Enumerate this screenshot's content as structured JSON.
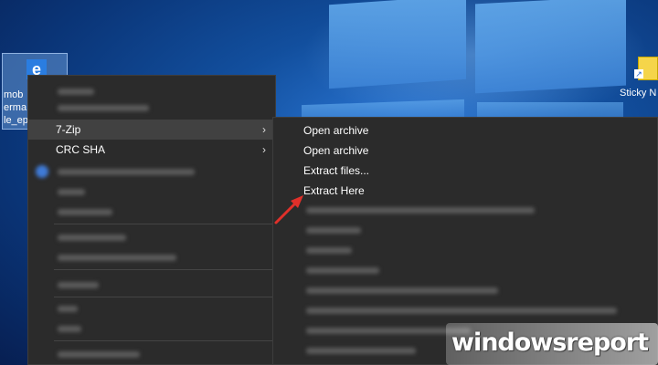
{
  "desktop": {
    "selected_icon": {
      "label": "mob\nerma\nle_ep",
      "icon": "edge-icon"
    },
    "sticky_icon": {
      "label": "Sticky N",
      "icon": "sticky-notes-icon"
    }
  },
  "context_menu": {
    "items": [
      {
        "label": "7-Zip",
        "has_submenu": true,
        "highlighted": true
      },
      {
        "label": "CRC SHA",
        "has_submenu": true,
        "highlighted": false
      }
    ]
  },
  "submenu_7zip": {
    "items": [
      {
        "label": "Open archive"
      },
      {
        "label": "Open archive"
      },
      {
        "label": "Extract files..."
      },
      {
        "label": "Extract Here"
      }
    ]
  },
  "annotation": {
    "color": "#e0302a",
    "icon": "red-arrow-icon"
  },
  "watermark": {
    "text": "windowsreport"
  },
  "colors": {
    "menu_bg": "#2b2b2b",
    "menu_highlight": "#414141",
    "desktop_accent": "#1a5fb4"
  }
}
